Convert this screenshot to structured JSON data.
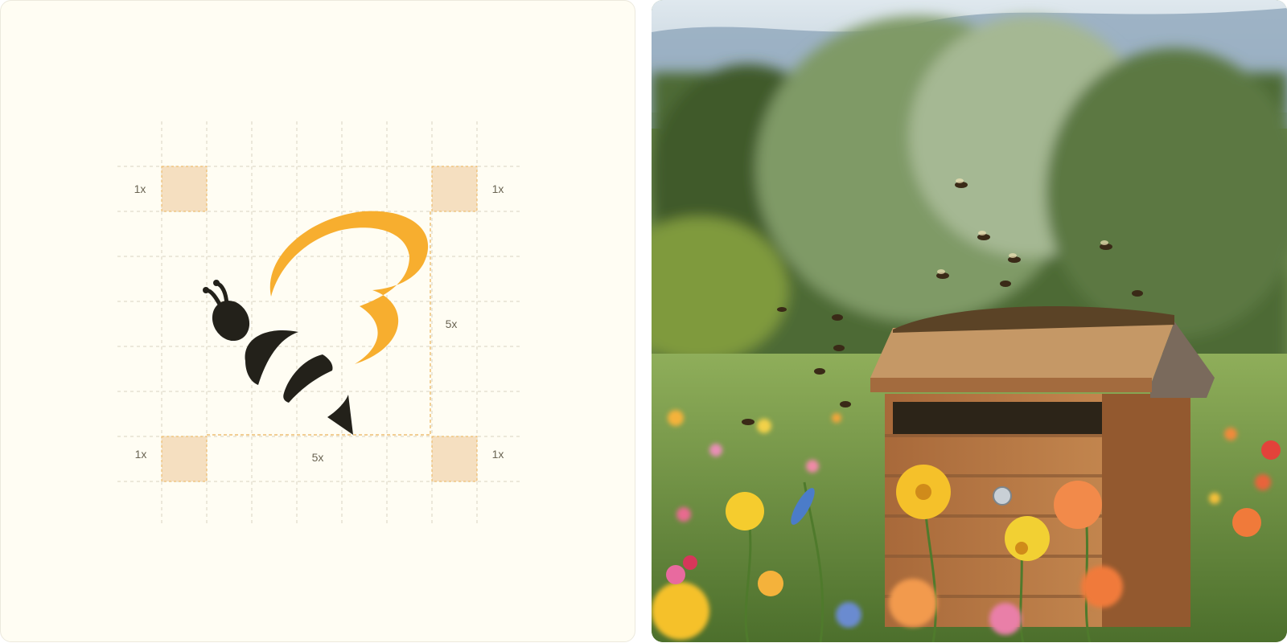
{
  "logo_construction": {
    "margin_labels": [
      "1x",
      "1x",
      "1x",
      "1x"
    ],
    "logo_size_labels": [
      "5x",
      "5x"
    ]
  },
  "colors": {
    "panel_background": "#fffdf3",
    "grid_line": "#d9d3c2",
    "guide_line": "#e9b25a",
    "margin_square": "#f5dfc0",
    "logo_accent": "#f7ae2f",
    "logo_dark": "#23211a"
  },
  "photo": {
    "subject": "wooden beehive in a wildflower meadow with flying bees"
  }
}
